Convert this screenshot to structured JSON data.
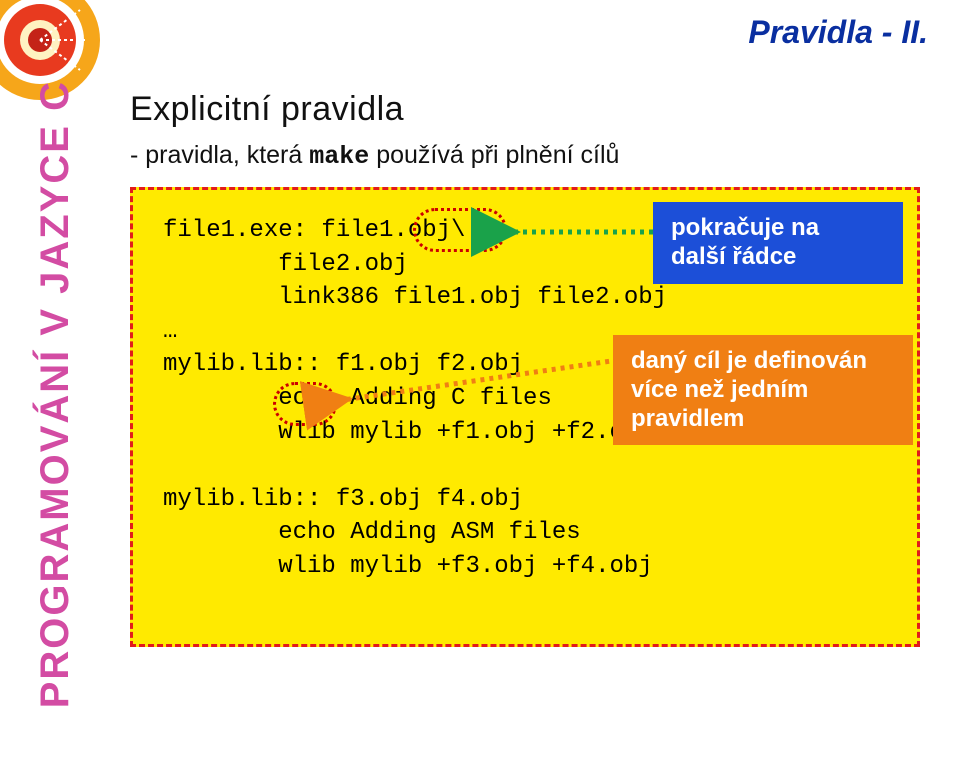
{
  "header": {
    "title": "Pravidla - II."
  },
  "sidebar": {
    "vertical_text": "PROGRAMOVÁNÍ V JAZYCE C"
  },
  "content": {
    "subheading": "Explicitní pravidla",
    "description_prefix": "- pravidla, která ",
    "description_code": "make",
    "description_suffix": " používá při plnění cílů"
  },
  "code": {
    "line1": "file1.exe: file1.obj\\",
    "line2": "        file2.obj",
    "line3": "        link386 file1.obj file2.obj",
    "line4": "…",
    "line5": "mylib.lib:: f1.obj f2.obj",
    "line6": "        echo Adding C files",
    "line7": "        wlib mylib +f1.obj +f2.obj",
    "line8": "",
    "line9": "mylib.lib:: f3.obj f4.obj",
    "line10": "        echo Adding ASM files",
    "line11": "        wlib mylib +f3.obj +f4.obj"
  },
  "callouts": {
    "c1_line1": "pokračuje na",
    "c1_line2": "další řádce",
    "c2_line1": "daný cíl je definován",
    "c2_line2": "více než jedním",
    "c2_line3": "pravidlem"
  }
}
